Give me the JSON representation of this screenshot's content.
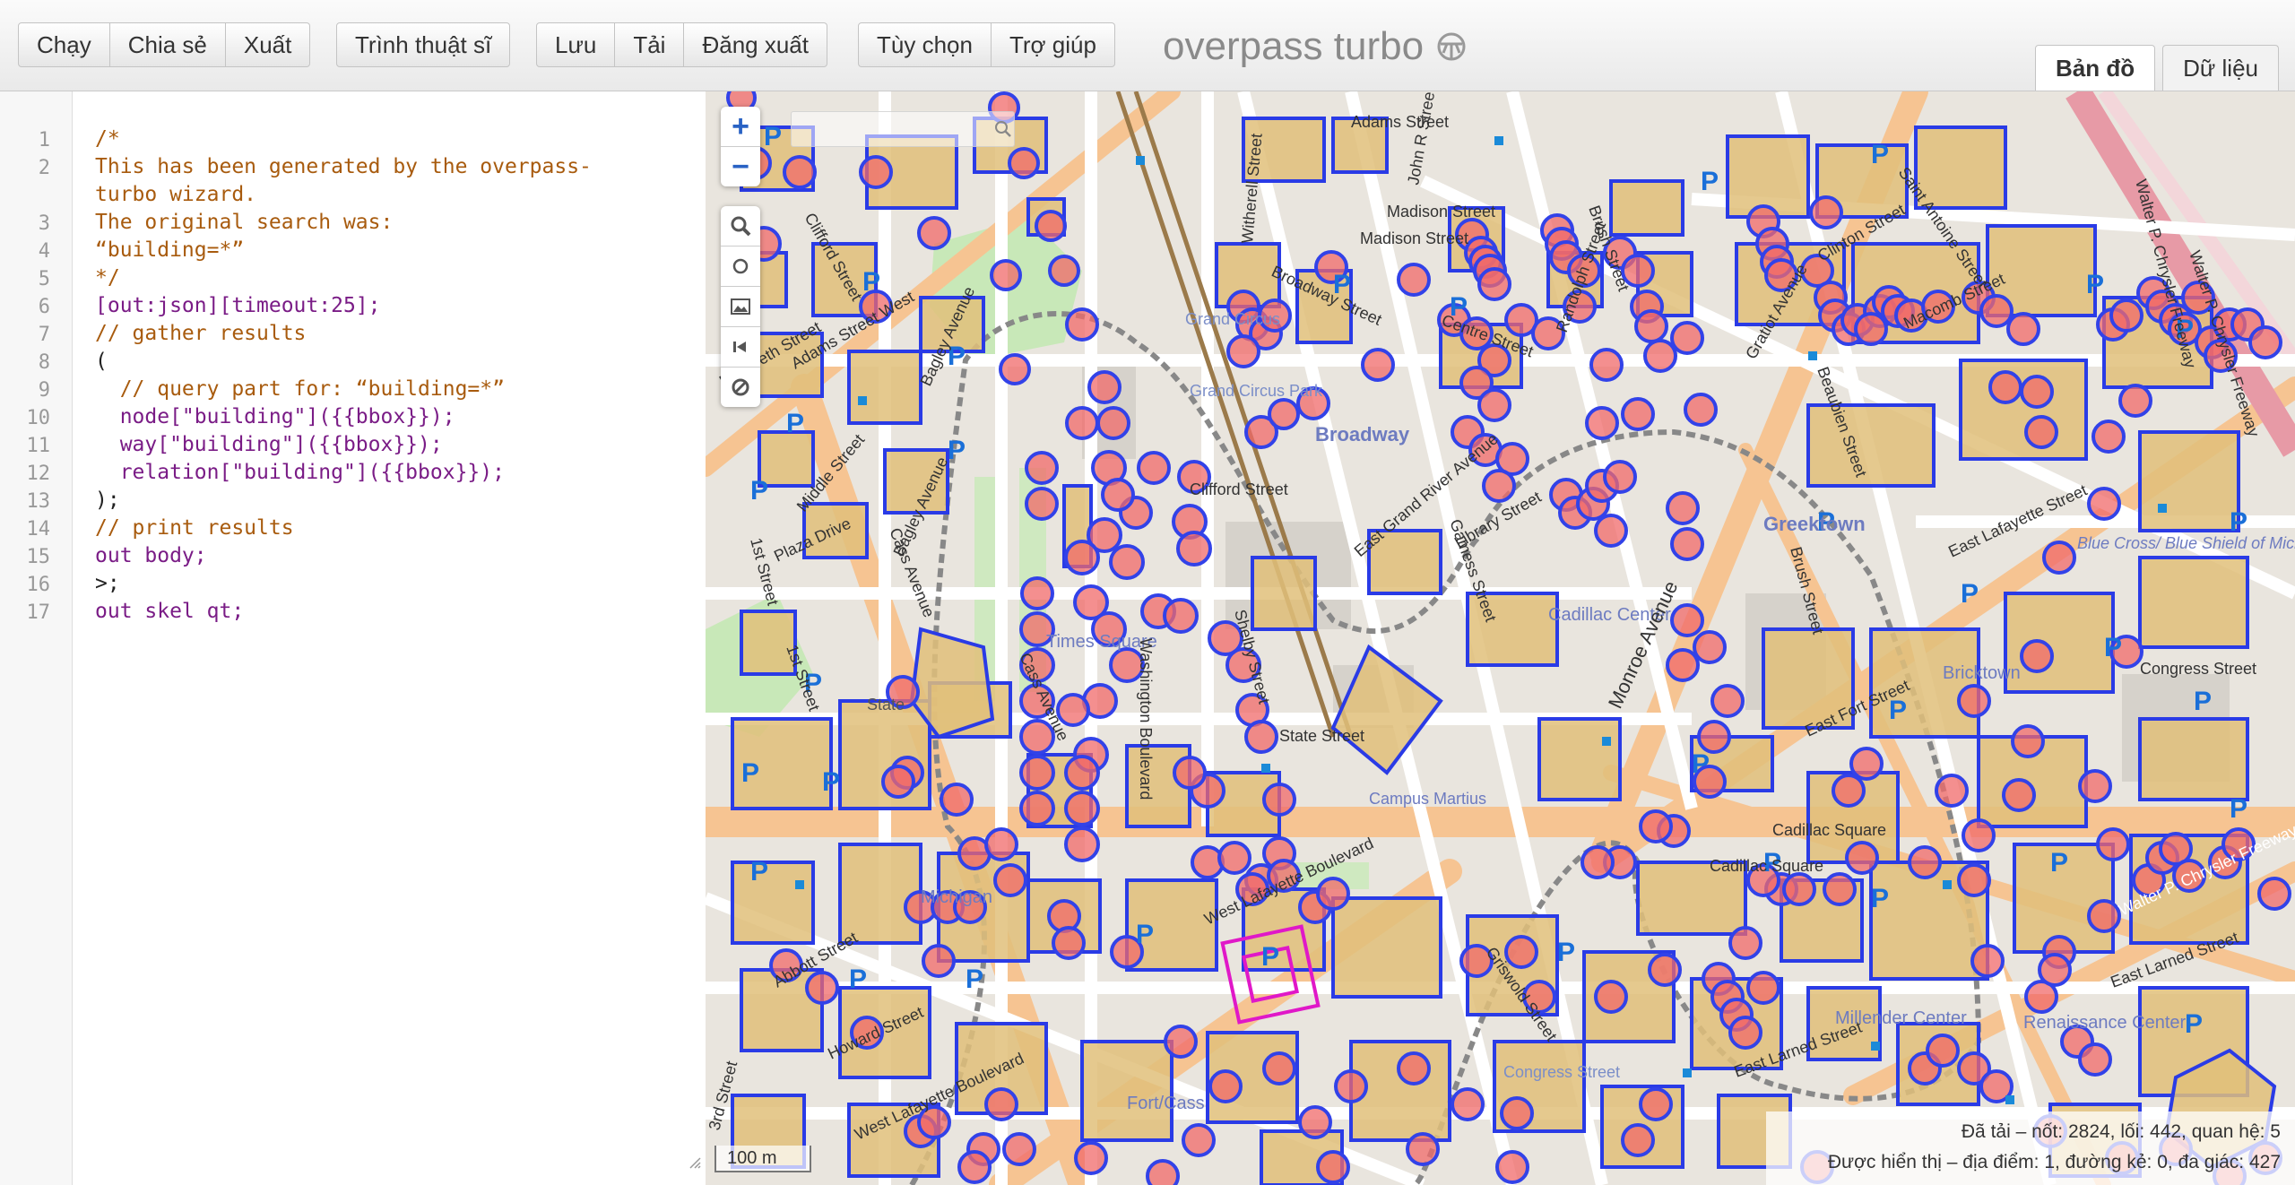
{
  "toolbar": {
    "run": "Chạy",
    "share": "Chia sẻ",
    "export": "Xuất",
    "wizard": "Trình thuật sĩ",
    "save": "Lưu",
    "load": "Tải",
    "logout": "Đăng xuất",
    "settings": "Tùy chọn",
    "help": "Trợ giúp"
  },
  "brand": {
    "name": "overpass turbo",
    "logo_icon": "overpass-logo-icon"
  },
  "tabs": {
    "map": "Bản đồ",
    "data": "Dữ liệu",
    "active": "map"
  },
  "editor": {
    "line_numbers": [
      "1",
      "2",
      "",
      "3",
      "4",
      "5",
      "6",
      "7",
      "8",
      "9",
      "10",
      "11",
      "12",
      "13",
      "14",
      "15",
      "16",
      "17"
    ],
    "lines": [
      "/*",
      "This has been generated by the overpass-",
      "turbo wizard.",
      "The original search was:",
      "“building=*”",
      "*/",
      "[out:json][timeout:25];",
      "// gather results",
      "(",
      "  // query part for: “building=*”",
      "  node[\"building\"]({{bbox}});",
      "  way[\"building\"]({{bbox}});",
      "  relation[\"building\"]({{bbox}});",
      ");",
      "// print results",
      "out body;",
      ">;",
      "out skel qt;"
    ]
  },
  "map": {
    "scale": "100 m",
    "zoom_in": "+",
    "zoom_out": "−",
    "search_placeholder": "",
    "labels": [
      "Adams Street",
      "John R Street",
      "Madison Street",
      "Madison Street",
      "Broadway Street",
      "Centre Street",
      "Randolph Street",
      "Brush Street",
      "Gratiot Avenue",
      "Clinton Street",
      "Saint Antoine Street",
      "Macomb Street",
      "Walter P. Chrysler Freeway",
      "Walter P. Chrysler Freeway",
      "Grand Circus",
      "Grand Circus Park",
      "Broadway",
      "Clifford Street",
      "Witherell Street",
      "East Grand River Avenue",
      "Library Street",
      "Gamess Street",
      "Cadillac Center",
      "Monroe Avenue",
      "Greektown",
      "Beaubien Street",
      "East Lafayette Street",
      "Blue Cross/ Blue Shield of Michigan Campus",
      "Bricktown",
      "Congress Street",
      "East Fort Street",
      "Brush Street",
      "Times Square",
      "Washington Boulevard",
      "Shelby Street",
      "State Street",
      "Campus Martius",
      "Cadillac Square",
      "Cadillac Square",
      "Griswold Street",
      "West Lafayette Boulevard",
      "Michigan",
      "Cass Avenue",
      "Cass Avenue",
      "Bagley Avenue",
      "Bagley Avenue",
      "1st Street",
      "1st Street",
      "Adams Street West",
      "Middle Street",
      "Plaza Drive",
      "Clifford Street",
      "Elizabeth Street",
      "Abbott Street",
      "Howard Street",
      "West Lafayette Boulevard",
      "Fort/Cass",
      "Congress Street",
      "East Larned Street",
      "Millender Center",
      "Renaissance Center",
      "Walter P. Chrysler Freeway",
      "East Larned Street",
      "3rd Street",
      "State"
    ],
    "stats_line1": "Đã tải – nốt: 2824, lối: 442, quan hệ: 5",
    "stats_line2": "Được hiển thị – địa điểm: 1, đường kẻ: 0, đa giác: 427"
  },
  "icons": [
    "zoom-icon",
    "circle-icon",
    "image-icon",
    "first-icon",
    "cancel-icon",
    "search-icon",
    "resize-icon"
  ]
}
